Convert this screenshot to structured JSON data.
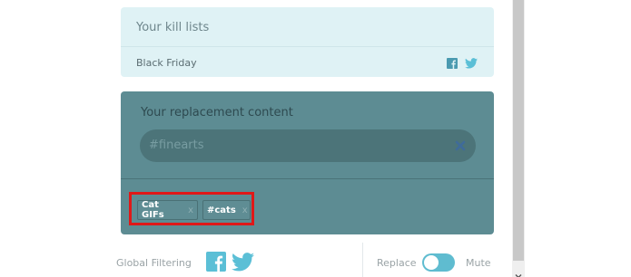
{
  "kill_lists": {
    "title": "Your kill lists",
    "items": [
      {
        "label": "Black Friday",
        "share_icons": [
          "facebook-icon",
          "twitter-icon"
        ]
      }
    ]
  },
  "replacement": {
    "title": "Your replacement content",
    "input_value": "#finearts",
    "tags": [
      {
        "label": "Cat GIFs",
        "remove": "x"
      },
      {
        "label": "#cats",
        "remove": "x"
      }
    ]
  },
  "footer": {
    "global_label": "Global Filtering",
    "social_icons": [
      "facebook-icon",
      "twitter-icon"
    ],
    "replace_label": "Replace",
    "mute_label": "Mute",
    "mode": "replace"
  },
  "colors": {
    "accent": "#5fbcd0",
    "kill_bg": "#dff2f5",
    "replacement_bg": "#5d8c93",
    "highlight": "#e01818",
    "facebook": "#4a9ab0",
    "twitter": "#5bbfd6"
  }
}
